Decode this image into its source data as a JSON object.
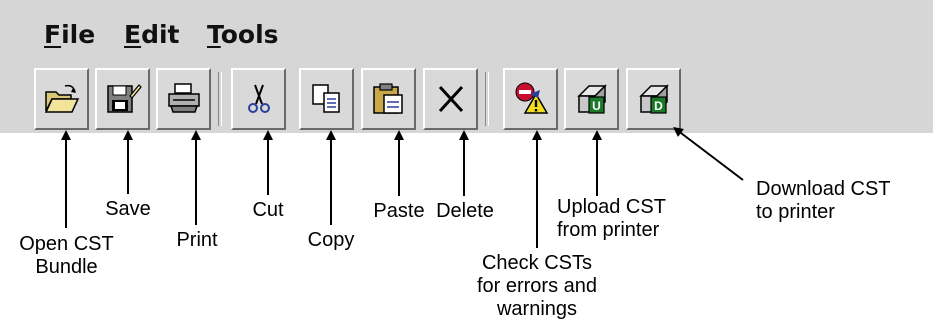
{
  "menu": {
    "file": "File",
    "edit": "Edit",
    "tools": "Tools"
  },
  "toolbar": {
    "buttons": [
      {
        "id": "open",
        "icon": "open-folder-icon"
      },
      {
        "id": "save",
        "icon": "save-disk-icon"
      },
      {
        "id": "print",
        "icon": "printer-icon"
      },
      {
        "id": "cut",
        "icon": "scissors-icon"
      },
      {
        "id": "copy",
        "icon": "copy-icon"
      },
      {
        "id": "paste",
        "icon": "paste-clipboard-icon"
      },
      {
        "id": "delete",
        "icon": "delete-x-icon"
      },
      {
        "id": "check",
        "icon": "check-errors-icon"
      },
      {
        "id": "upload",
        "icon": "upload-printer-icon"
      },
      {
        "id": "download",
        "icon": "download-printer-icon"
      }
    ]
  },
  "callouts": {
    "open": [
      "Open CST",
      "Bundle"
    ],
    "save": [
      "Save"
    ],
    "print": [
      "Print"
    ],
    "cut": [
      "Cut"
    ],
    "copy": [
      "Copy"
    ],
    "paste": [
      "Paste"
    ],
    "delete": [
      "Delete"
    ],
    "check": [
      "Check CSTs",
      "for errors and",
      "warnings"
    ],
    "upload": [
      "Upload CST",
      "from printer"
    ],
    "download": [
      "Download CST",
      "to printer"
    ]
  },
  "colors": {
    "window_bg": "#d6d6d6",
    "arrow": "#000000",
    "badge_green": "#1a7a2a",
    "badge_red": "#c8102e"
  }
}
